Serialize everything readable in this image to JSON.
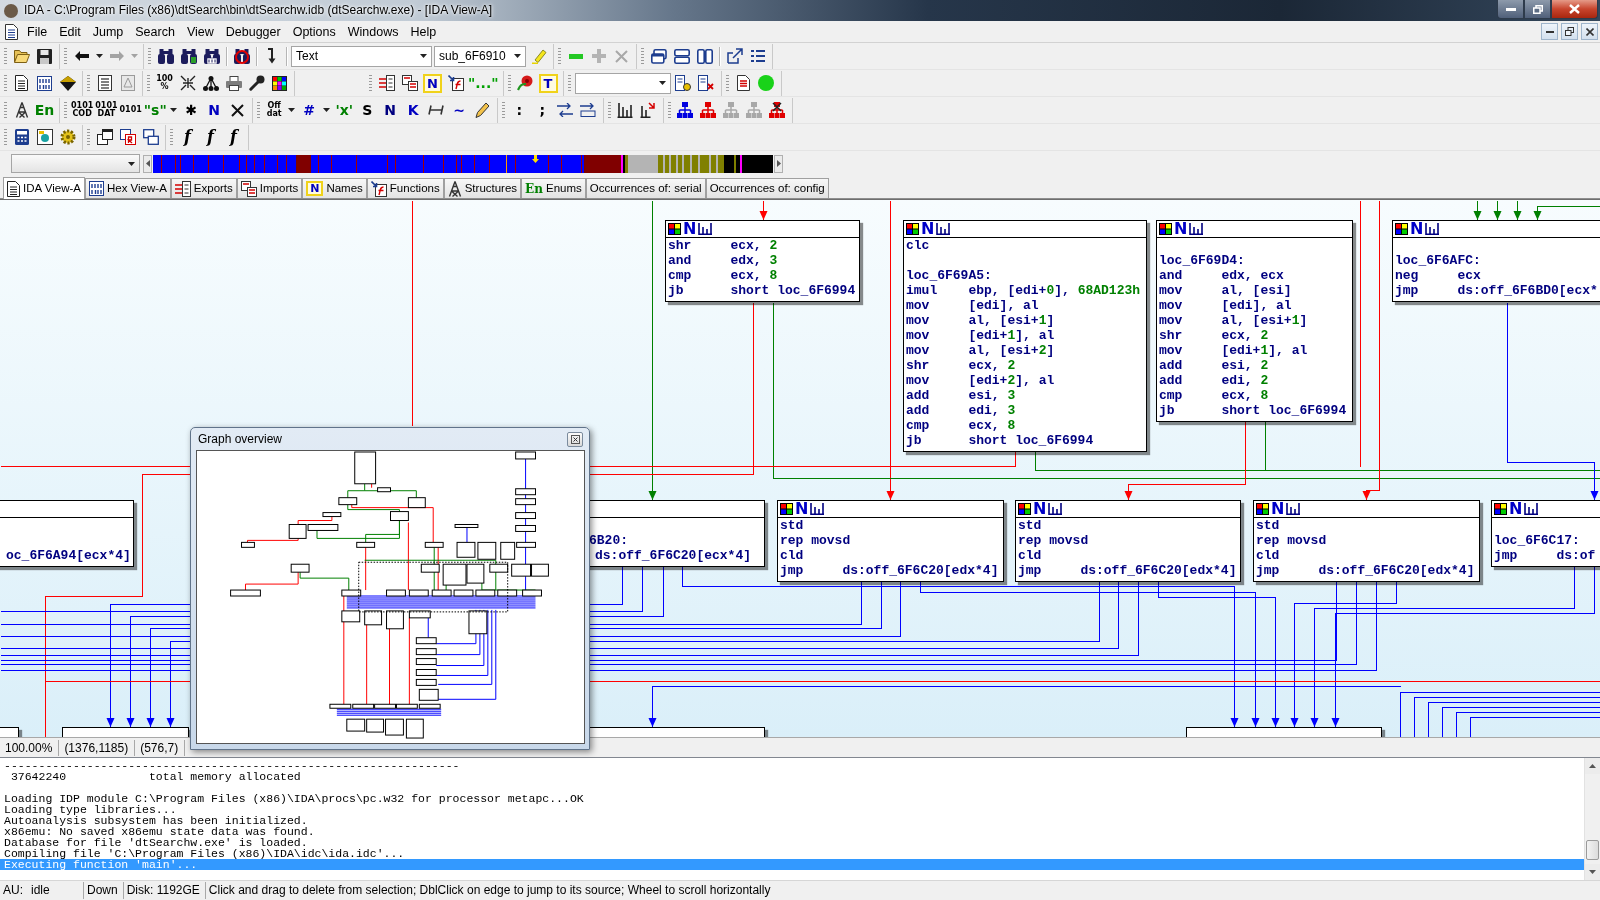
{
  "window": {
    "title": "IDA - C:\\Program Files (x86)\\dtSearch\\bin\\dtSearchw.idb (dtSearchw.exe) - [IDA View-A]"
  },
  "menu": [
    "File",
    "Edit",
    "Jump",
    "Search",
    "View",
    "Debugger",
    "Options",
    "Windows",
    "Help"
  ],
  "toolbars": [
    [
      [
        {
          "kind": "icon"
        },
        {
          "kind": "icon"
        }
      ],
      [
        {
          "kind": "icon"
        },
        {
          "kind": "icon"
        },
        {
          "kind": "icon"
        },
        {
          "kind": "icon"
        }
      ],
      [
        {
          "kind": "icon"
        },
        {
          "kind": "icon"
        },
        {
          "kind": "icon"
        },
        {
          "kind": "separator"
        },
        {
          "kind": "icon"
        },
        {
          "kind": "separator"
        },
        {
          "kind": "icon"
        },
        {
          "kind": "separator"
        },
        {
          "kind": "dropdown",
          "value": "Text"
        },
        {
          "kind": "dropdown",
          "value": "sub_6F6910"
        },
        {
          "kind": "icon"
        }
      ],
      [
        {
          "kind": "icon"
        },
        {
          "kind": "icon"
        },
        {
          "kind": "icon"
        }
      ],
      [
        {
          "kind": "icon"
        },
        {
          "kind": "icon"
        },
        {
          "kind": "icon"
        },
        {
          "kind": "separator"
        },
        {
          "kind": "icon"
        },
        {
          "kind": "icon"
        }
      ]
    ],
    [
      [
        {
          "kind": "icon"
        },
        {
          "kind": "icon"
        },
        {
          "kind": "icon"
        }
      ],
      [
        {
          "kind": "icon"
        },
        {
          "kind": "icon"
        }
      ],
      [
        {
          "kind": "stack",
          "label": "100\n%",
          "color": "#000000"
        },
        {
          "kind": "icon"
        },
        {
          "kind": "icon"
        },
        {
          "kind": "icon"
        },
        {
          "kind": "icon"
        },
        {
          "kind": "icon"
        }
      ],
      [
        {
          "kind": "icon"
        },
        {
          "kind": "icon"
        },
        {
          "kind": "tile",
          "label": "N",
          "color": "#0000c0"
        },
        {
          "kind": "icon"
        },
        {
          "kind": "glyph",
          "label": "\"...\"",
          "color": "#00a000"
        }
      ],
      [
        {
          "kind": "icon"
        },
        {
          "kind": "tile",
          "label": "T",
          "color": "#0000c0"
        }
      ],
      [
        {
          "kind": "dropdown"
        },
        {
          "kind": "icon"
        },
        {
          "kind": "icon"
        }
      ],
      [
        {
          "kind": "icon"
        },
        {
          "kind": "icon"
        }
      ]
    ],
    [
      [
        {
          "kind": "icon"
        },
        {
          "kind": "glyph",
          "label": "En",
          "color": "#008000"
        }
      ],
      [
        {
          "kind": "stack",
          "label": "0101\nCOD",
          "color": "#000000"
        },
        {
          "kind": "stack",
          "label": "0101\nDAT",
          "color": "#000000"
        },
        {
          "kind": "stack",
          "label": "0101",
          "color": "#000000"
        },
        {
          "kind": "glyph",
          "label": "\"s\"",
          "color": "#008000"
        },
        {
          "kind": "icon"
        },
        {
          "kind": "glyph",
          "label": "✱",
          "color": "#000000"
        },
        {
          "kind": "glyph",
          "label": "N",
          "color": "#0000c0"
        },
        {
          "kind": "icon"
        }
      ],
      [
        {
          "kind": "stack",
          "label": "Off\ndat",
          "color": "#000000"
        },
        {
          "kind": "icon"
        },
        {
          "kind": "glyph",
          "label": "#",
          "color": "#0000c0"
        },
        {
          "kind": "icon"
        },
        {
          "kind": "glyph",
          "label": "'x'",
          "color": "#008000"
        },
        {
          "kind": "glyph",
          "label": "S",
          "color": "#000000"
        },
        {
          "kind": "glyph",
          "label": "N",
          "color": "#000080"
        },
        {
          "kind": "glyph",
          "label": "K",
          "color": "#0000c0"
        },
        {
          "kind": "icon"
        },
        {
          "kind": "glyph",
          "label": "~",
          "color": "#0000c0"
        },
        {
          "kind": "icon"
        }
      ],
      [
        {
          "kind": "glyph",
          "label": ":",
          "color": "#000000"
        },
        {
          "kind": "glyph",
          "label": ";",
          "color": "#000000"
        },
        {
          "kind": "icon"
        },
        {
          "kind": "icon"
        }
      ],
      [
        {
          "kind": "icon"
        },
        {
          "kind": "icon"
        }
      ],
      [
        {
          "kind": "icon"
        },
        {
          "kind": "icon"
        },
        {
          "kind": "icon"
        },
        {
          "kind": "icon"
        },
        {
          "kind": "icon"
        }
      ]
    ],
    [
      [
        {
          "kind": "icon"
        },
        {
          "kind": "icon"
        },
        {
          "kind": "icon"
        }
      ],
      [
        {
          "kind": "icon"
        },
        {
          "kind": "icon"
        },
        {
          "kind": "icon"
        }
      ],
      [
        {
          "kind": "italic",
          "label": "f",
          "color": "#000000"
        },
        {
          "kind": "italic",
          "label": "f",
          "color": "#000000"
        },
        {
          "kind": "italic",
          "label": "f",
          "color": "#000000"
        }
      ]
    ]
  ],
  "tabs": [
    {
      "kind": "disassembly",
      "label": "IDA View-A",
      "selected": true
    },
    {
      "kind": "hex",
      "label": "Hex View-A",
      "selected": false
    },
    {
      "kind": "exports",
      "label": "Exports",
      "selected": false
    },
    {
      "kind": "imports",
      "label": "Imports",
      "selected": false
    },
    {
      "kind": "names",
      "glyph": "N",
      "label": "Names",
      "selected": false
    },
    {
      "kind": "functions",
      "label": "Functions",
      "selected": false
    },
    {
      "kind": "structures",
      "label": "Structures",
      "selected": false
    },
    {
      "kind": "enums",
      "glyph": "En",
      "label": "Enums",
      "selected": false
    },
    {
      "kind": "occurrences",
      "label": "Occurrences of: serial",
      "selected": false
    },
    {
      "kind": "occurrences",
      "label": "Occurrences of: config",
      "selected": false
    }
  ],
  "graph": {
    "nodes": [
      {
        "selected": false,
        "glyph": "N",
        "lines": [
          {
            "kind": "insn",
            "op": "shr",
            "args": [
              "ecx, ",
              "2"
            ]
          },
          {
            "kind": "insn",
            "op": "and",
            "args": [
              "edx, ",
              "3"
            ]
          },
          {
            "kind": "insn",
            "op": "cmp",
            "args": [
              "ecx, ",
              "8"
            ]
          },
          {
            "kind": "insn",
            "op": "jb",
            "args": [
              "short loc_6F6994"
            ]
          }
        ]
      },
      {
        "selected": false,
        "glyph": "N",
        "lines": [
          {
            "kind": "insn",
            "op": "clc"
          },
          {
            "kind": "blank"
          },
          {
            "kind": "label",
            "text": "loc_6F69A5:"
          },
          {
            "kind": "insn",
            "op": "imul",
            "args": [
              "ebp, [edi+",
              "0",
              "], ",
              "68AD123h"
            ]
          },
          {
            "kind": "insn",
            "op": "mov",
            "args": [
              "[edi], al"
            ]
          },
          {
            "kind": "insn",
            "op": "mov",
            "args": [
              "al, [esi+",
              "1",
              "]"
            ]
          },
          {
            "kind": "insn",
            "op": "mov",
            "args": [
              "[edi+",
              "1",
              "], al"
            ]
          },
          {
            "kind": "insn",
            "op": "mov",
            "args": [
              "al, [esi+",
              "2",
              "]"
            ]
          },
          {
            "kind": "insn",
            "op": "shr",
            "args": [
              "ecx, ",
              "2"
            ]
          },
          {
            "kind": "insn",
            "op": "mov",
            "args": [
              "[edi+",
              "2",
              "], al"
            ]
          },
          {
            "kind": "insn",
            "op": "add",
            "args": [
              "esi, ",
              "3"
            ]
          },
          {
            "kind": "insn",
            "op": "add",
            "args": [
              "edi, ",
              "3"
            ]
          },
          {
            "kind": "insn",
            "op": "cmp",
            "args": [
              "ecx, ",
              "8"
            ]
          },
          {
            "kind": "insn",
            "op": "jb",
            "args": [
              "short loc_6F6994"
            ]
          }
        ]
      },
      {
        "selected": false,
        "glyph": "N",
        "lines": [
          {
            "kind": "blank"
          },
          {
            "kind": "label",
            "text": "loc_6F69D4:"
          },
          {
            "kind": "insn",
            "op": "and",
            "args": [
              "edx, ecx"
            ]
          },
          {
            "kind": "insn",
            "op": "mov",
            "args": [
              "al, [esi]"
            ]
          },
          {
            "kind": "insn",
            "op": "mov",
            "args": [
              "[edi], al"
            ]
          },
          {
            "kind": "insn",
            "op": "mov",
            "args": [
              "al, [esi+",
              "1",
              "]"
            ]
          },
          {
            "kind": "insn",
            "op": "shr",
            "args": [
              "ecx, ",
              "2"
            ]
          },
          {
            "kind": "insn",
            "op": "mov",
            "args": [
              "[edi+",
              "1",
              "], al"
            ]
          },
          {
            "kind": "insn",
            "op": "add",
            "args": [
              "esi, ",
              "2"
            ]
          },
          {
            "kind": "insn",
            "op": "add",
            "args": [
              "edi, ",
              "2"
            ]
          },
          {
            "kind": "insn",
            "op": "cmp",
            "args": [
              "ecx, ",
              "8"
            ]
          },
          {
            "kind": "insn",
            "op": "jb",
            "args": [
              "short loc_6F6994"
            ]
          }
        ]
      },
      {
        "selected": false,
        "glyph": "N",
        "lines": [
          {
            "kind": "blank"
          },
          {
            "kind": "label",
            "text": "loc_6F6AFC:"
          },
          {
            "kind": "insn",
            "op": "neg",
            "args": [
              "ecx"
            ]
          },
          {
            "kind": "insn",
            "op": "jmp",
            "args": [
              "ds:off_6F6BD0[ecx*"
            ]
          }
        ]
      },
      {
        "selected": false,
        "lines": [
          {
            "kind": "blank"
          },
          {
            "kind": "blank"
          },
          {
            "kind": "operand",
            "args": [
              "oc_6F6A94[ecx*4]"
            ]
          }
        ]
      },
      {
        "selected": false,
        "lines": [
          {
            "kind": "blank"
          },
          {
            "kind": "label",
            "text": "6B20:"
          },
          {
            "kind": "operand",
            "args": [
              "ds:off_6F6C20[ecx*4]"
            ]
          }
        ]
      },
      {
        "selected": false,
        "glyph": "N",
        "lines": [
          {
            "kind": "insn",
            "op": "std"
          },
          {
            "kind": "insn",
            "op": "rep movsd"
          },
          {
            "kind": "insn",
            "op": "cld"
          },
          {
            "kind": "insn",
            "op": "jmp",
            "args": [
              "ds:off_6F6C20[edx*4]"
            ]
          }
        ]
      },
      {
        "selected": false,
        "glyph": "N",
        "lines": [
          {
            "kind": "insn",
            "op": "std"
          },
          {
            "kind": "insn",
            "op": "rep movsd"
          },
          {
            "kind": "insn",
            "op": "cld"
          },
          {
            "kind": "insn",
            "op": "jmp",
            "args": [
              "ds:off_6F6C20[edx*4]"
            ]
          }
        ]
      },
      {
        "selected": false,
        "glyph": "N",
        "lines": [
          {
            "kind": "insn",
            "op": "std"
          },
          {
            "kind": "insn",
            "op": "rep movsd"
          },
          {
            "kind": "insn",
            "op": "cld"
          },
          {
            "kind": "insn",
            "op": "jmp",
            "args": [
              "ds:off_6F6C20[edx*4]"
            ]
          }
        ]
      },
      {
        "selected": false,
        "glyph": "N",
        "lines": [
          {
            "kind": "blank"
          },
          {
            "kind": "label",
            "text": "loc_6F6C17:"
          },
          {
            "kind": "insn",
            "op": "jmp",
            "args": [
              "ds:of"
            ]
          }
        ]
      },
      {
        "selected": false
      },
      {
        "selected": false
      },
      {
        "selected": false
      },
      {
        "selected": false
      }
    ]
  },
  "overview": {
    "title": "Graph overview"
  },
  "graph_status": [
    "100.00%",
    "(1376,1185)",
    "(576,7)"
  ],
  "output": {
    "lines": [
      {
        "text": "------------------------------------------------------------------",
        "selected": false
      },
      {
        "text": " 37642240            total memory allocated",
        "selected": false
      },
      {
        "selected": false
      },
      {
        "text": "Loading IDP module C:\\Program Files (x86)\\IDA\\procs\\pc.w32 for processor metapc...OK",
        "selected": false
      },
      {
        "text": "Loading type libraries...",
        "selected": false
      },
      {
        "text": "Autoanalysis subsystem has been initialized.",
        "selected": false
      },
      {
        "text": "x86emu: No saved x86emu state data was found.",
        "selected": false
      },
      {
        "text": "Database for file 'dtSearchw.exe' is loaded.",
        "selected": false
      },
      {
        "text": "Compiling file 'C:\\Program Files (x86)\\IDA\\idc\\ida.idc'...",
        "selected": false
      },
      {
        "text": "Executing function 'main'...",
        "selected": true
      }
    ]
  },
  "status_bar": {
    "au_label": "AU:",
    "au_state": "idle",
    "direction": "Down",
    "disk": "Disk: 1192GE",
    "message": "Click and drag to delete from selection; DblClick on edge to jump to its source; Wheel to scroll horizontally"
  }
}
